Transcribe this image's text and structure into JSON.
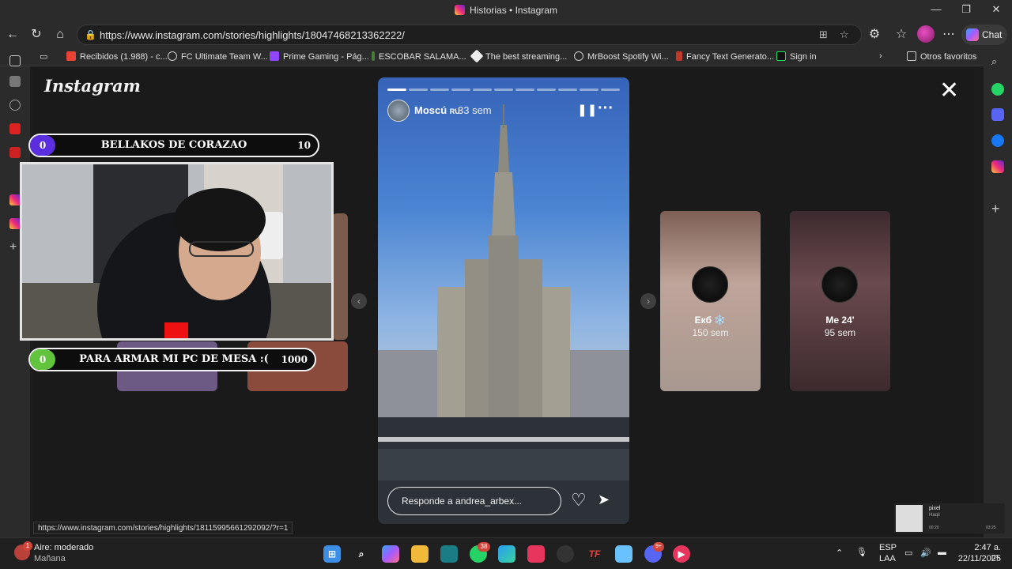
{
  "window": {
    "title": "Historias • Instagram"
  },
  "browser": {
    "url": "https://www.instagram.com/stories/highlights/18047468213362222/",
    "chat_label": "Chat",
    "bookmarks": [
      "Recibidos (1.988) - c...",
      "FC Ultimate Team W...",
      "Prime Gaming - Pág...",
      "ESCOBAR SALAMA...",
      "The best streaming...",
      "MrBoost Spotify Wi...",
      "Fancy Text Generato...",
      "Sign in"
    ],
    "other_favorites": "Otros favoritos",
    "status_url": "https://www.instagram.com/stories/highlights/18115995661292092/?r=1"
  },
  "instagram": {
    "logo": "Instagram",
    "story": {
      "user": "Moscú",
      "flag": "RU",
      "time": "33 sem",
      "reply_placeholder": "Responde a andrea_arbex...",
      "segments_total": 11,
      "segments_done": 1
    },
    "side_stories": [
      {
        "name": "Екб ❄️",
        "time": "150 sem"
      },
      {
        "name": "Me 24'",
        "time": "95 sem"
      }
    ]
  },
  "overlay": {
    "goal_top": {
      "current": "0",
      "label": "BELLAKOS DE CORAZAO",
      "target": "10"
    },
    "goal_bottom": {
      "current": "0",
      "label": "PARA ARMAR MI PC DE MESA :(",
      "target": "1000"
    }
  },
  "mini_player": {
    "title": "pixel",
    "subtitle": "Haqii",
    "time_left": "00:20",
    "time_right": "03:25"
  },
  "taskbar": {
    "weather_title": "Aire: moderado",
    "weather_sub": "Mañana",
    "weather_badge": "1",
    "whatsapp_badge": "38",
    "discord_badge": "9+",
    "lang_top": "ESP",
    "lang_bottom": "LAA",
    "time": "2:47 a. m.",
    "date": "22/11/2025"
  },
  "colors": {
    "goal_top_accent": "#5b2ee0",
    "goal_bottom_accent": "#62c43c",
    "instagram_gradient": "#ee2a7b"
  }
}
